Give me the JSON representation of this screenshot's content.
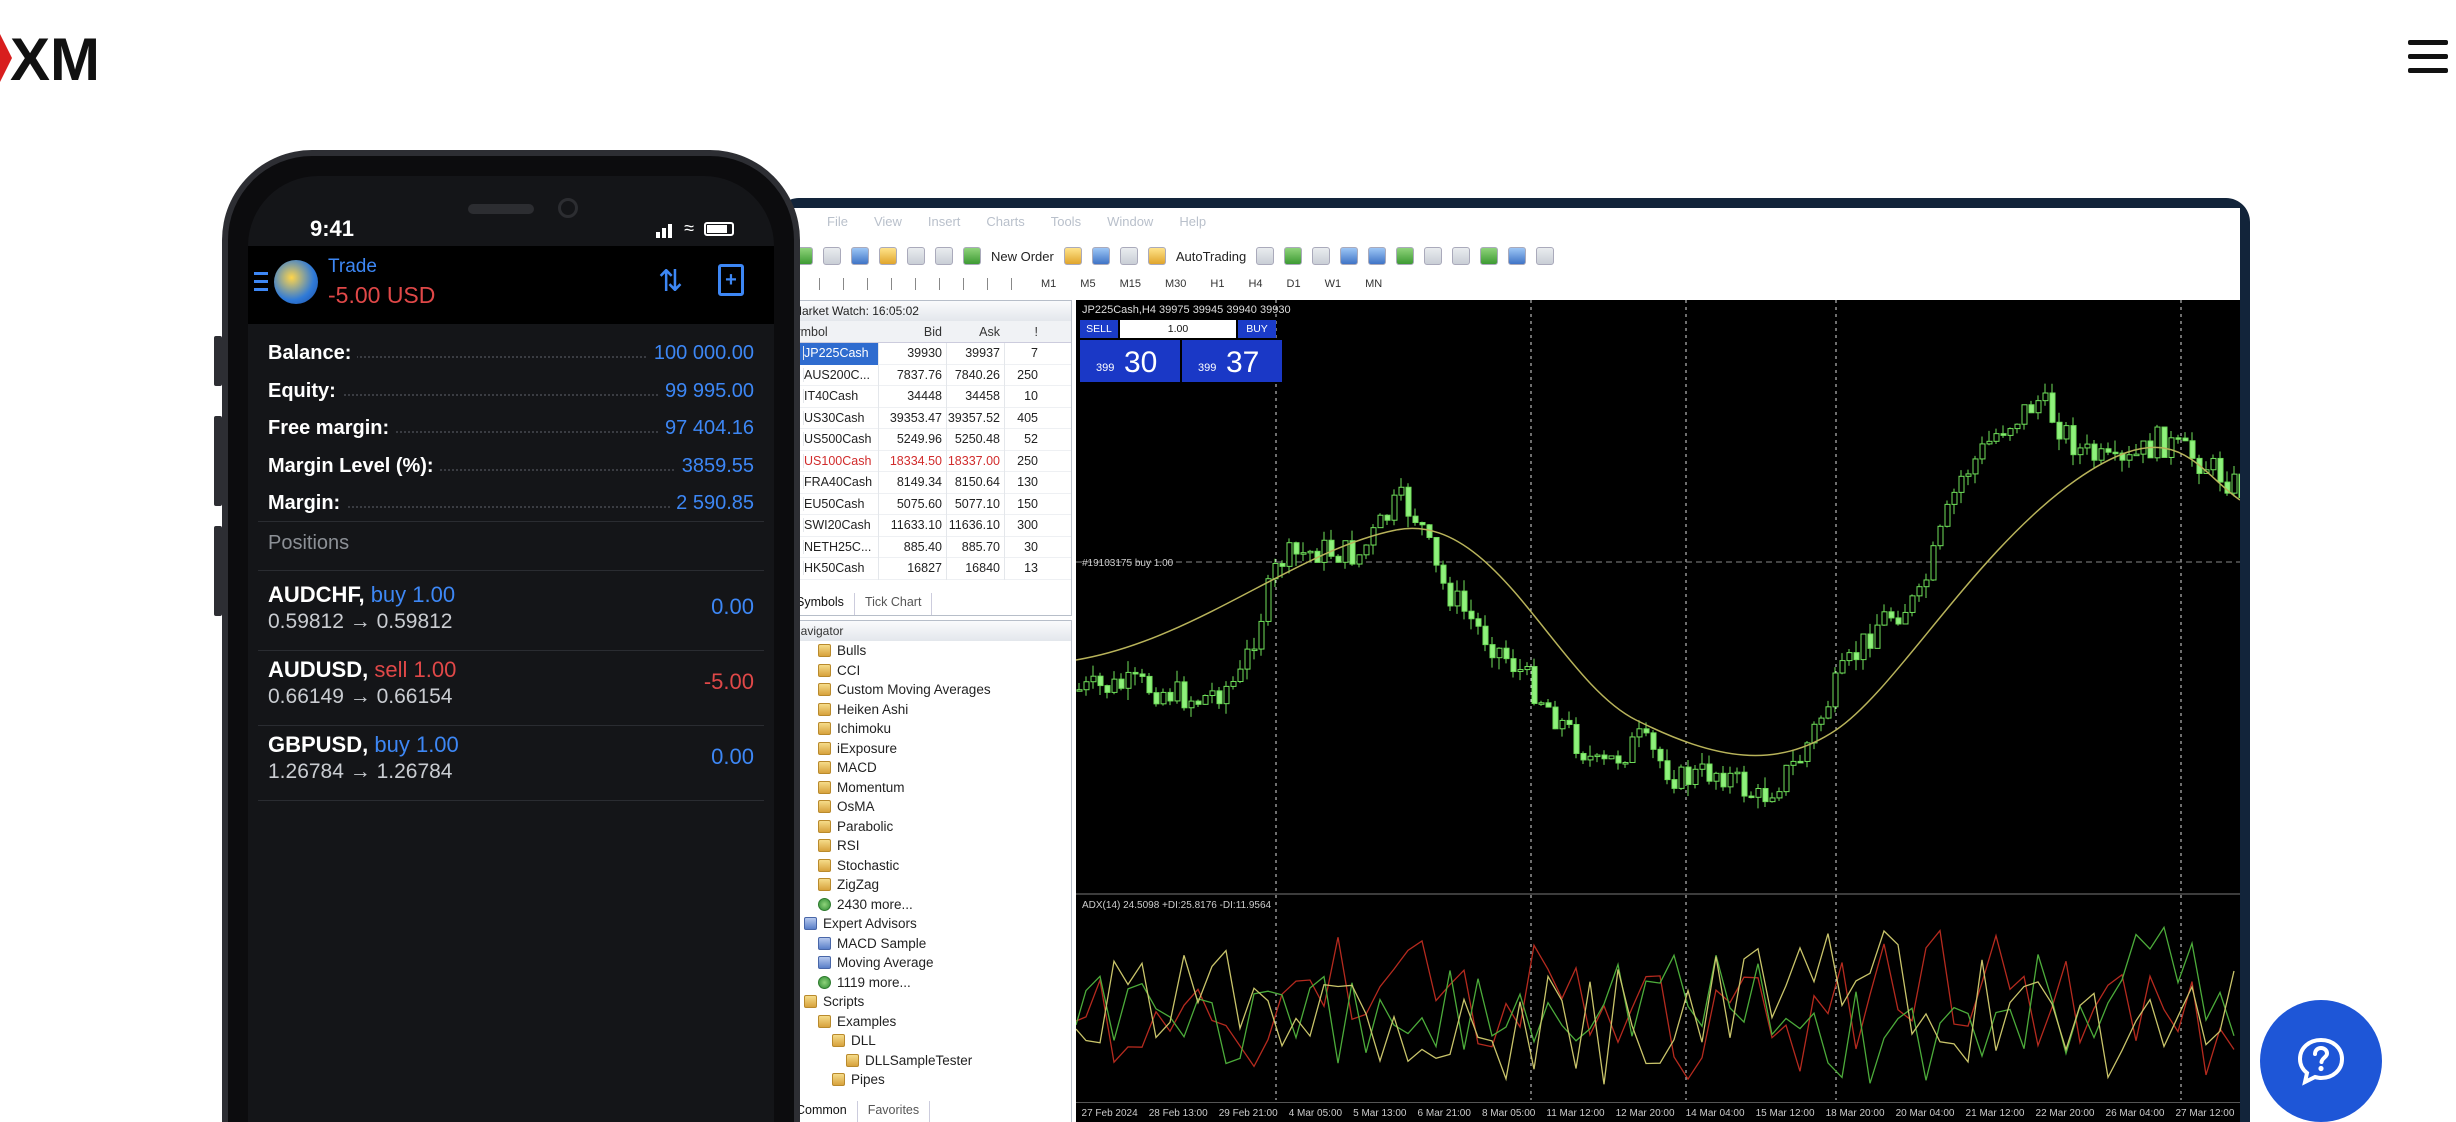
{
  "brand": {
    "logo_text": "XM"
  },
  "desktop": {
    "menu": [
      "File",
      "View",
      "Insert",
      "Charts",
      "Tools",
      "Window",
      "Help"
    ],
    "toolbar": {
      "new_order": "New Order",
      "autotrading": "AutoTrading"
    },
    "timeframes": [
      "M1",
      "M5",
      "M15",
      "M30",
      "H1",
      "H4",
      "D1",
      "W1",
      "MN"
    ],
    "market_watch": {
      "title": "Market Watch: 16:05:02",
      "columns": [
        "Symbol",
        "Bid",
        "Ask",
        "!"
      ],
      "rows": [
        {
          "symbol": "JP225Cash",
          "bid": "39930",
          "ask": "39937",
          "spread": "7"
        },
        {
          "symbol": "AUS200C...",
          "bid": "7837.76",
          "ask": "7840.26",
          "spread": "250"
        },
        {
          "symbol": "IT40Cash",
          "bid": "34448",
          "ask": "34458",
          "spread": "10"
        },
        {
          "symbol": "US30Cash",
          "bid": "39353.47",
          "ask": "39357.52",
          "spread": "405"
        },
        {
          "symbol": "US500Cash",
          "bid": "5249.96",
          "ask": "5250.48",
          "spread": "52"
        },
        {
          "symbol": "US100Cash",
          "bid": "18334.50",
          "ask": "18337.00",
          "spread": "250"
        },
        {
          "symbol": "FRA40Cash",
          "bid": "8149.34",
          "ask": "8150.64",
          "spread": "130"
        },
        {
          "symbol": "EU50Cash",
          "bid": "5075.60",
          "ask": "5077.10",
          "spread": "150"
        },
        {
          "symbol": "SWI20Cash",
          "bid": "11633.10",
          "ask": "11636.10",
          "spread": "300"
        },
        {
          "symbol": "NETH25C...",
          "bid": "885.40",
          "ask": "885.70",
          "spread": "30"
        },
        {
          "symbol": "HK50Cash",
          "bid": "16827",
          "ask": "16840",
          "spread": "13"
        }
      ],
      "tabs": [
        "Symbols",
        "Tick Chart"
      ]
    },
    "navigator": {
      "title": "Navigator",
      "items": [
        {
          "label": "Bulls",
          "icon": "indicator-icon",
          "indent": 2
        },
        {
          "label": "CCI",
          "icon": "indicator-icon",
          "indent": 2
        },
        {
          "label": "Custom Moving Averages",
          "icon": "indicator-icon",
          "indent": 2
        },
        {
          "label": "Heiken Ashi",
          "icon": "indicator-icon",
          "indent": 2
        },
        {
          "label": "Ichimoku",
          "icon": "indicator-icon",
          "indent": 2
        },
        {
          "label": "iExposure",
          "icon": "indicator-icon",
          "indent": 2
        },
        {
          "label": "MACD",
          "icon": "indicator-icon",
          "indent": 2
        },
        {
          "label": "Momentum",
          "icon": "indicator-icon",
          "indent": 2
        },
        {
          "label": "OsMA",
          "icon": "indicator-icon",
          "indent": 2
        },
        {
          "label": "Parabolic",
          "icon": "indicator-icon",
          "indent": 2
        },
        {
          "label": "RSI",
          "icon": "indicator-icon",
          "indent": 2
        },
        {
          "label": "Stochastic",
          "icon": "indicator-icon",
          "indent": 2
        },
        {
          "label": "ZigZag",
          "icon": "indicator-icon",
          "indent": 2
        },
        {
          "label": "2430 more...",
          "icon": "globe-icon",
          "indent": 2
        },
        {
          "label": "Expert Advisors",
          "icon": "expert-icon",
          "indent": 1
        },
        {
          "label": "MACD Sample",
          "icon": "expert-icon",
          "indent": 2
        },
        {
          "label": "Moving Average",
          "icon": "expert-icon",
          "indent": 2
        },
        {
          "label": "1119 more...",
          "icon": "globe-icon",
          "indent": 2
        },
        {
          "label": "Scripts",
          "icon": "folder-icon",
          "indent": 1
        },
        {
          "label": "Examples",
          "icon": "folder-icon",
          "indent": 2
        },
        {
          "label": "DLL",
          "icon": "folder-icon",
          "indent": 3
        },
        {
          "label": "DLLSampleTester",
          "icon": "script-icon",
          "indent": 4
        },
        {
          "label": "Pipes",
          "icon": "folder-icon",
          "indent": 3
        }
      ],
      "tabs": [
        "Common",
        "Favorites"
      ]
    },
    "chart": {
      "title": "JP225Cash,H4  39975 39945 39940 39930",
      "ticket": {
        "sell": "SELL",
        "buy": "BUY",
        "lot": "1.00",
        "sell_small": "399",
        "sell_big": "30",
        "buy_small": "399",
        "buy_big": "37"
      },
      "position_label": "#19103175 buy 1.00",
      "indicator_label": "ADX(14) 24.5098 +DI:25.8176 -DI:11.9564",
      "x_labels": [
        "27 Feb 2024",
        "28 Feb 13:00",
        "29 Feb 21:00",
        "4 Mar 05:00",
        "5 Mar 13:00",
        "6 Mar 21:00",
        "8 Mar 05:00",
        "11 Mar 12:00",
        "12 Mar 20:00",
        "14 Mar 04:00",
        "15 Mar 12:00",
        "18 Mar 20:00",
        "20 Mar 04:00",
        "21 Mar 12:00",
        "22 Mar 20:00",
        "26 Mar 04:00",
        "27 Mar 12:00"
      ]
    }
  },
  "phone": {
    "time": "9:41",
    "header": {
      "title": "Trade",
      "amount": "-5.00 USD"
    },
    "account": [
      {
        "label": "Balance:",
        "value": "100 000.00"
      },
      {
        "label": "Equity:",
        "value": "99 995.00"
      },
      {
        "label": "Free margin:",
        "value": "97 404.16"
      },
      {
        "label": "Margin Level (%):",
        "value": "3859.55"
      },
      {
        "label": "Margin:",
        "value": "2 590.85"
      }
    ],
    "positions_title": "Positions",
    "positions": [
      {
        "symbol": "AUDCHF,",
        "side": "buy 1.00",
        "prices": "0.59812 → 0.59812",
        "pl": "0.00",
        "type": "buy"
      },
      {
        "symbol": "AUDUSD,",
        "side": "sell 1.00",
        "prices": "0.66149 → 0.66154",
        "pl": "-5.00",
        "type": "sell"
      },
      {
        "symbol": "GBPUSD,",
        "side": "buy 1.00",
        "prices": "1.26784 → 1.26784",
        "pl": "0.00",
        "type": "buy"
      }
    ]
  }
}
